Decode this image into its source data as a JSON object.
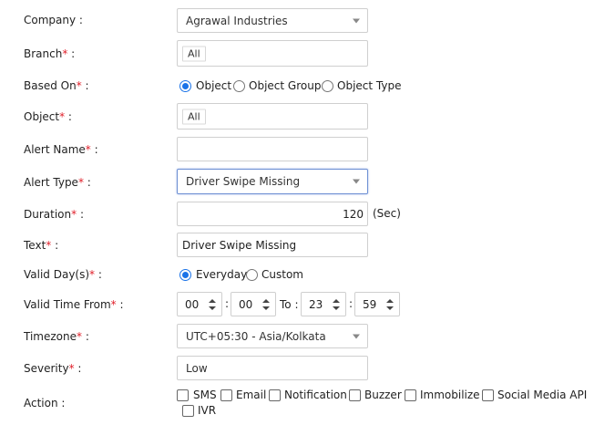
{
  "company": {
    "label": "Company :",
    "value": "Agrawal Industries"
  },
  "branch": {
    "label": "Branch",
    "suffix": " :",
    "value": "All"
  },
  "based_on": {
    "label": "Based On",
    "suffix": " :",
    "options": [
      "Object",
      "Object Group",
      "Object Type"
    ],
    "selected": "Object"
  },
  "object": {
    "label": "Object",
    "suffix": " :",
    "value": "All"
  },
  "alert_name": {
    "label": "Alert Name",
    "suffix": " :",
    "value": ""
  },
  "alert_type": {
    "label": "Alert Type",
    "suffix": " :",
    "value": "Driver Swipe Missing"
  },
  "duration": {
    "label": "Duration",
    "suffix": " :",
    "value": "120",
    "unit": "(Sec)"
  },
  "text": {
    "label": "Text",
    "suffix": " :",
    "value": "Driver Swipe Missing"
  },
  "valid_days": {
    "label": "Valid Day(s)",
    "suffix": " :",
    "options": [
      "Everyday",
      "Custom"
    ],
    "selected": "Everyday"
  },
  "valid_time": {
    "label": "Valid Time From",
    "suffix": " :",
    "from_hour": "00",
    "from_min": "00",
    "to_label": "To",
    "to_hour": "23",
    "to_min": "59"
  },
  "timezone": {
    "label": "Timezone",
    "suffix": " :",
    "value": "UTC+05:30 - Asia/Kolkata"
  },
  "severity": {
    "label": "Severity",
    "suffix": " :",
    "value": "Low"
  },
  "action": {
    "label": "Action :",
    "options": [
      "SMS",
      "Email",
      "Notification",
      "Buzzer",
      "Immobilize",
      "Social Media API",
      "IVR"
    ]
  },
  "required_marker": "*",
  "colors": {
    "required": "#e0202a",
    "radio_accent": "#1a73e8",
    "focus_border": "#6d8fd3"
  }
}
